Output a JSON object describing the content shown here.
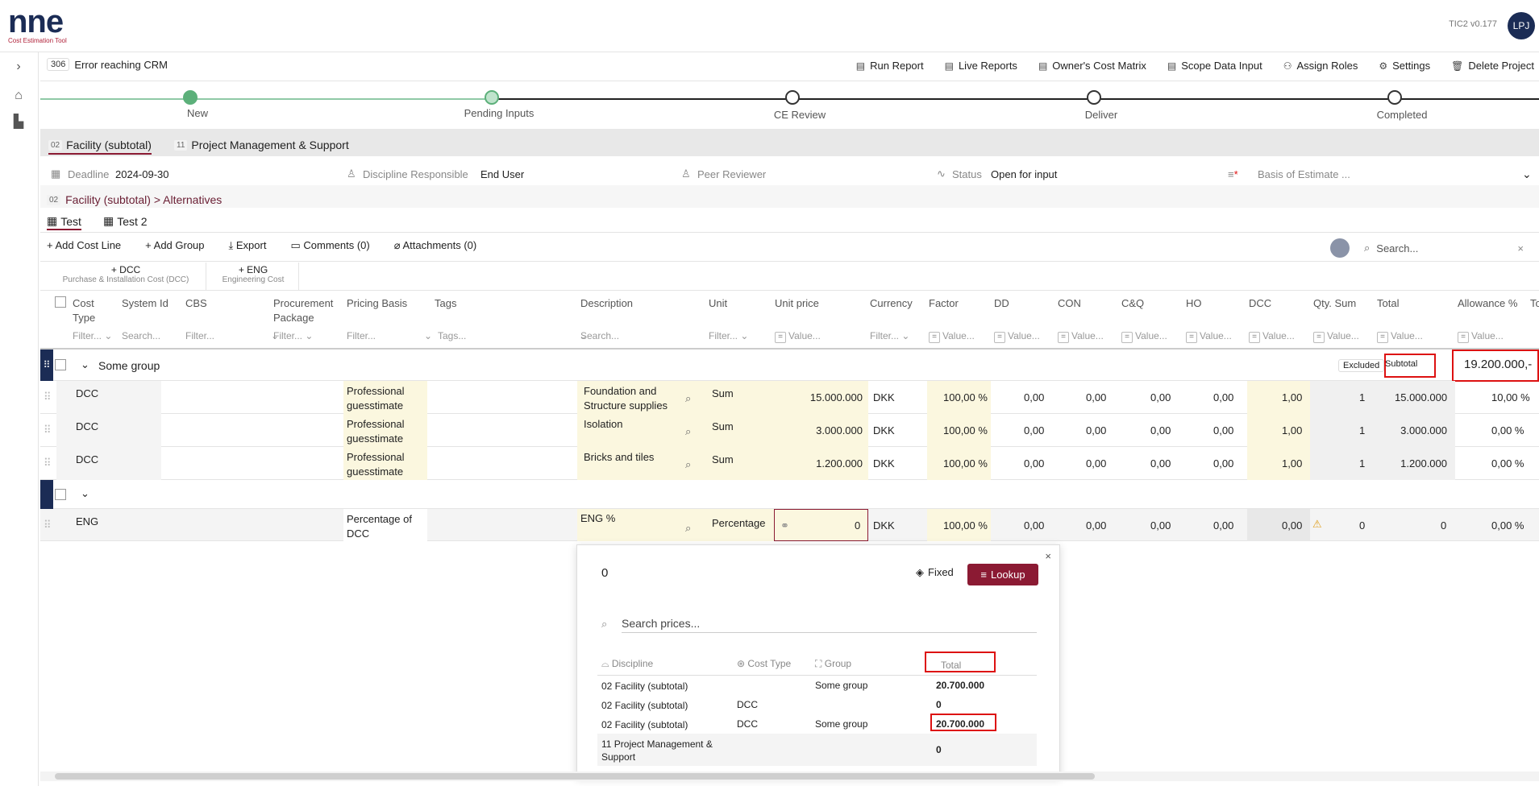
{
  "app": {
    "logo": "nne",
    "logo_sub": "Cost Estimation Tool",
    "version": "TIC2 v0.177",
    "user": "LPJ"
  },
  "project": {
    "number": "306",
    "name": "Error reaching CRM"
  },
  "actions": [
    "Run Report",
    "Live Reports",
    "Owner's Cost Matrix",
    "Scope Data Input",
    "Assign Roles",
    "Settings",
    "Delete Project"
  ],
  "steps": [
    "New",
    "Pending Inputs",
    "CE Review",
    "Deliver",
    "Completed"
  ],
  "facility_tabs": [
    {
      "num": "02",
      "label": "Facility (subtotal)"
    },
    {
      "num": "11",
      "label": "Project Management & Support"
    }
  ],
  "info": {
    "deadline_label": "Deadline",
    "deadline": "2024-09-30",
    "disc_label": "Discipline Responsible",
    "disc": "End User",
    "peer_label": "Peer Reviewer",
    "status_label": "Status",
    "status": "Open for input",
    "basis_label": "Basis of Estimate ..."
  },
  "breadcrumb": {
    "num": "02",
    "path": "Facility (subtotal) > Alternatives"
  },
  "view_tabs": [
    "Test",
    "Test 2"
  ],
  "toolbar": {
    "add_line": "+ Add Cost Line",
    "add_group": "+ Add Group",
    "export": "Export",
    "comments": "Comments (0)",
    "attachments": "Attachments (0)",
    "search_placeholder": "Search..."
  },
  "add_buttons": [
    {
      "label": "+ DCC",
      "sub": "Purchase & Installation Cost (DCC)"
    },
    {
      "label": "+ ENG",
      "sub": "Engineering Cost"
    }
  ],
  "columns": [
    "Cost Type",
    "System Id",
    "CBS",
    "Procurement Package",
    "Pricing Basis",
    "Tags",
    "Description",
    "Unit",
    "Unit price",
    "Currency",
    "Factor",
    "DD",
    "CON",
    "C&Q",
    "HO",
    "DCC",
    "Qty. Sum",
    "Total",
    "Allowance %",
    "To"
  ],
  "filters": {
    "filter": "Filter...",
    "search": "Search...",
    "tags": "Tags...",
    "value": "Value..."
  },
  "group": {
    "name": "Some group",
    "excluded": "Excluded",
    "subtotal": "Subtotal",
    "amount": "19.200.000,-"
  },
  "rows": [
    {
      "type": "DCC",
      "pricing": "Professional guesstimate",
      "desc": "Foundation and Structure supplies",
      "unit": "Sum",
      "price": "15.000.000",
      "currency": "DKK",
      "factor": "100,00 %",
      "dd": "0,00",
      "con": "0,00",
      "cq": "0,00",
      "ho": "0,00",
      "dcc": "1,00",
      "qty": "1",
      "total": "15.000.000",
      "allow": "10,00 %"
    },
    {
      "type": "DCC",
      "pricing": "Professional guesstimate",
      "desc": "Isolation",
      "unit": "Sum",
      "price": "3.000.000",
      "currency": "DKK",
      "factor": "100,00 %",
      "dd": "0,00",
      "con": "0,00",
      "cq": "0,00",
      "ho": "0,00",
      "dcc": "1,00",
      "qty": "1",
      "total": "3.000.000",
      "allow": "0,00 %"
    },
    {
      "type": "DCC",
      "pricing": "Professional guesstimate",
      "desc": "Bricks and tiles",
      "unit": "Sum",
      "price": "1.200.000",
      "currency": "DKK",
      "factor": "100,00 %",
      "dd": "0,00",
      "con": "0,00",
      "cq": "0,00",
      "ho": "0,00",
      "dcc": "1,00",
      "qty": "1",
      "total": "1.200.000",
      "allow": "0,00 %"
    }
  ],
  "eng_row": {
    "type": "ENG",
    "pricing": "Percentage of DCC",
    "desc": "ENG %",
    "unit": "Percentage",
    "price": "0",
    "currency": "DKK",
    "factor": "100,00 %",
    "dd": "0,00",
    "con": "0,00",
    "cq": "0,00",
    "ho": "0,00",
    "dcc": "0,00",
    "qty": "0",
    "total": "0",
    "allow": "0,00 %"
  },
  "popup": {
    "value": "0",
    "fixed": "Fixed",
    "lookup": "Lookup",
    "search_placeholder": "Search prices...",
    "headers": [
      "Discipline",
      "Cost Type",
      "Group",
      "Total"
    ],
    "rows": [
      {
        "disc": "02 Facility (subtotal)",
        "ct": "",
        "grp": "Some group",
        "total": "20.700.000"
      },
      {
        "disc": "02 Facility (subtotal)",
        "ct": "DCC",
        "grp": "",
        "total": "0"
      },
      {
        "disc": "02 Facility (subtotal)",
        "ct": "DCC",
        "grp": "Some group",
        "total": "20.700.000"
      },
      {
        "disc": "11 Project Management & Support",
        "ct": "",
        "grp": "",
        "total": "0"
      }
    ]
  }
}
